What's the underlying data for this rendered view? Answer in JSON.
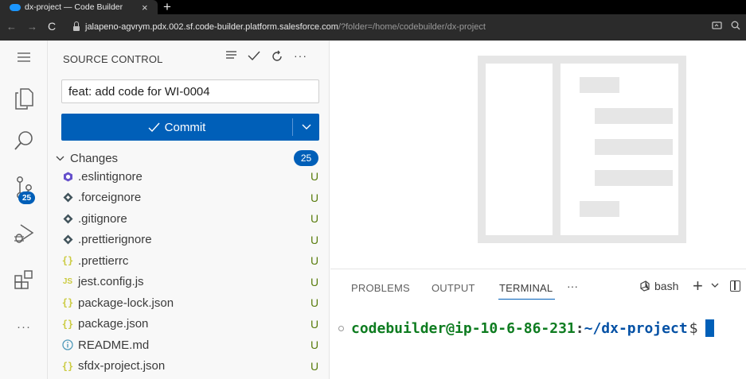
{
  "browser": {
    "tab_title": "dx-project — Code Builder",
    "tab_close": "×",
    "new_tab": "+",
    "back": "←",
    "forward": "→",
    "reload": "C",
    "url_host": "jalapeno-agvrym.pdx.002.sf.code-builder.platform.salesforce.com",
    "url_path": "/?folder=/home/codebuilder/dx-project",
    "favicon_color": "#1b96ff"
  },
  "activity_bar": {
    "items": [
      {
        "icon": "menu-icon"
      },
      {
        "icon": "explorer-icon"
      },
      {
        "icon": "search-icon"
      },
      {
        "icon": "source-control-icon"
      },
      {
        "icon": "run-debug-icon"
      },
      {
        "icon": "extensions-icon"
      },
      {
        "icon": "more-icon"
      }
    ],
    "source_control_badge": "25",
    "more_label": "···"
  },
  "source_control": {
    "title": "SOURCE CONTROL",
    "commit_message": "feat: add code for WI-0004",
    "commit_button_label": "Commit",
    "changes_label": "Changes",
    "changes_count": "25",
    "files": [
      {
        "name": ".eslintignore",
        "icon": "eslint-icon",
        "status": "U"
      },
      {
        "name": ".forceignore",
        "icon": "ignore-file-icon",
        "status": "U"
      },
      {
        "name": ".gitignore",
        "icon": "ignore-file-icon",
        "status": "U"
      },
      {
        "name": ".prettierignore",
        "icon": "ignore-file-icon",
        "status": "U"
      },
      {
        "name": ".prettierrc",
        "icon": "json-icon",
        "status": "U"
      },
      {
        "name": "jest.config.js",
        "icon": "js-icon",
        "status": "U"
      },
      {
        "name": "package-lock.json",
        "icon": "json-icon",
        "status": "U"
      },
      {
        "name": "package.json",
        "icon": "json-icon",
        "status": "U"
      },
      {
        "name": "README.md",
        "icon": "info-icon",
        "status": "U"
      },
      {
        "name": "sfdx-project.json",
        "icon": "json-icon",
        "status": "U"
      }
    ]
  },
  "panel": {
    "tabs": [
      {
        "label": "PROBLEMS"
      },
      {
        "label": "OUTPUT"
      },
      {
        "label": "TERMINAL",
        "active": true
      }
    ],
    "more": "···",
    "shell_label": "bash",
    "terminal": {
      "user_host": "codebuilder@ip-10-6-86-231",
      "separator": ":",
      "path": "~/dx-project",
      "prompt": "$"
    }
  },
  "colors": {
    "accent": "#005fb8",
    "untracked": "#587c0c",
    "terminal_user": "#0e7c20",
    "terminal_path": "#0451a5"
  }
}
